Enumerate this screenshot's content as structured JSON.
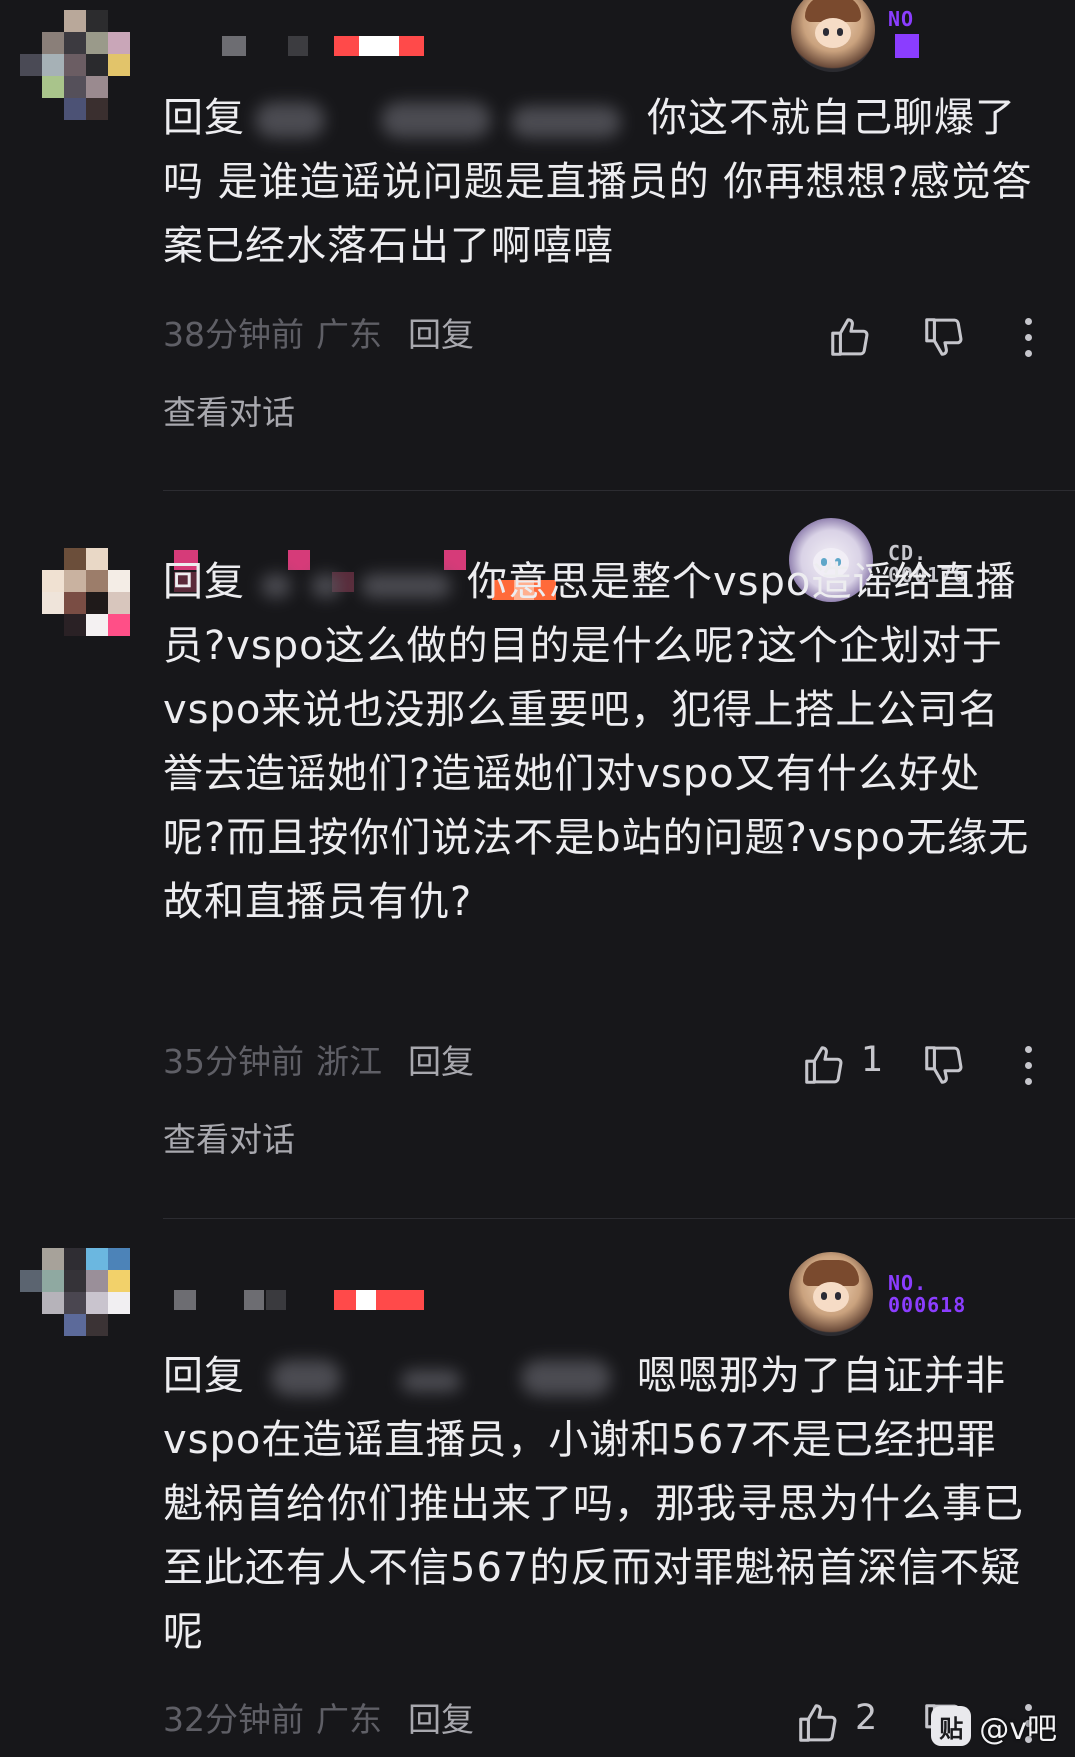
{
  "comments": [
    {
      "medal_badge_top": "NO",
      "medal_badge_num": "",
      "body_prefix": "回复",
      "body_text": "你这不就自己聊爆了吗 是谁造谣说问题是直播员的 你再想想?感觉答案已经水落石出了啊嘻嘻",
      "time": "38分钟前",
      "location": "广东",
      "reply_label": "回复",
      "like_count": "",
      "view_conversation": "查看对话"
    },
    {
      "medal_badge_top": "CD.",
      "medal_badge_num": "000176",
      "body_prefix": "回复",
      "body_text": "你意思是整个vspo造谣给直播员?vspo这么做的目的是什么呢?这个企划对于vspo来说也没那么重要吧，犯得上搭上公司名誉去造谣她们?造谣她们对vspo又有什么好处呢?而且按你们说法不是b站的问题?vspo无缘无故和直播员有仇?",
      "time": "35分钟前",
      "location": "浙江",
      "reply_label": "回复",
      "like_count": "1",
      "view_conversation": "查看对话"
    },
    {
      "medal_badge_top": "NO.",
      "medal_badge_num": "000618",
      "body_prefix": "回复",
      "body_text": "嗯嗯那为了自证并非vspo在造谣直播员，小谢和567不是已经把罪魁祸首给你们推出来了吗，那我寻思为什么事已至此还有人不信567的反而对罪魁祸首深信不疑呢",
      "time": "32分钟前",
      "location": "广东",
      "reply_label": "回复",
      "like_count": "2",
      "view_conversation": ""
    }
  ],
  "watermark": {
    "logo": "贴",
    "text": "@v吧"
  },
  "colors": {
    "background": "#17171a",
    "badge_purple": "#8b3dff",
    "meta_gray": "#5f5f66"
  },
  "icons": [
    "thumb-up-icon",
    "thumb-down-icon",
    "more-icon"
  ]
}
